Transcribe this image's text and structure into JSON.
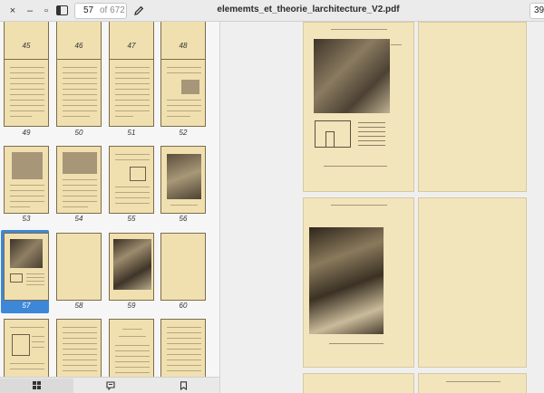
{
  "header": {
    "window_buttons": [
      "×",
      "–",
      "▫"
    ],
    "document_title": "elememts_et_theorie_larchitecture_V2.pdf",
    "current_page": "57",
    "page_count_text": "of 672",
    "zoom_value": "39"
  },
  "sidebar": {
    "thumbnail_labels": [
      "45",
      "46",
      "47",
      "48",
      "49",
      "50",
      "51",
      "52",
      "53",
      "54",
      "55",
      "56",
      "57",
      "58",
      "59",
      "60"
    ],
    "selected_page": "57"
  },
  "switcher": {
    "items": [
      "thumbnails-view-icon",
      "annotations-view-icon",
      "bookmarks-view-icon"
    ]
  },
  "colors": {
    "accent": "#3d87d9",
    "page": "#f2e4bb",
    "background": "#efefef"
  }
}
